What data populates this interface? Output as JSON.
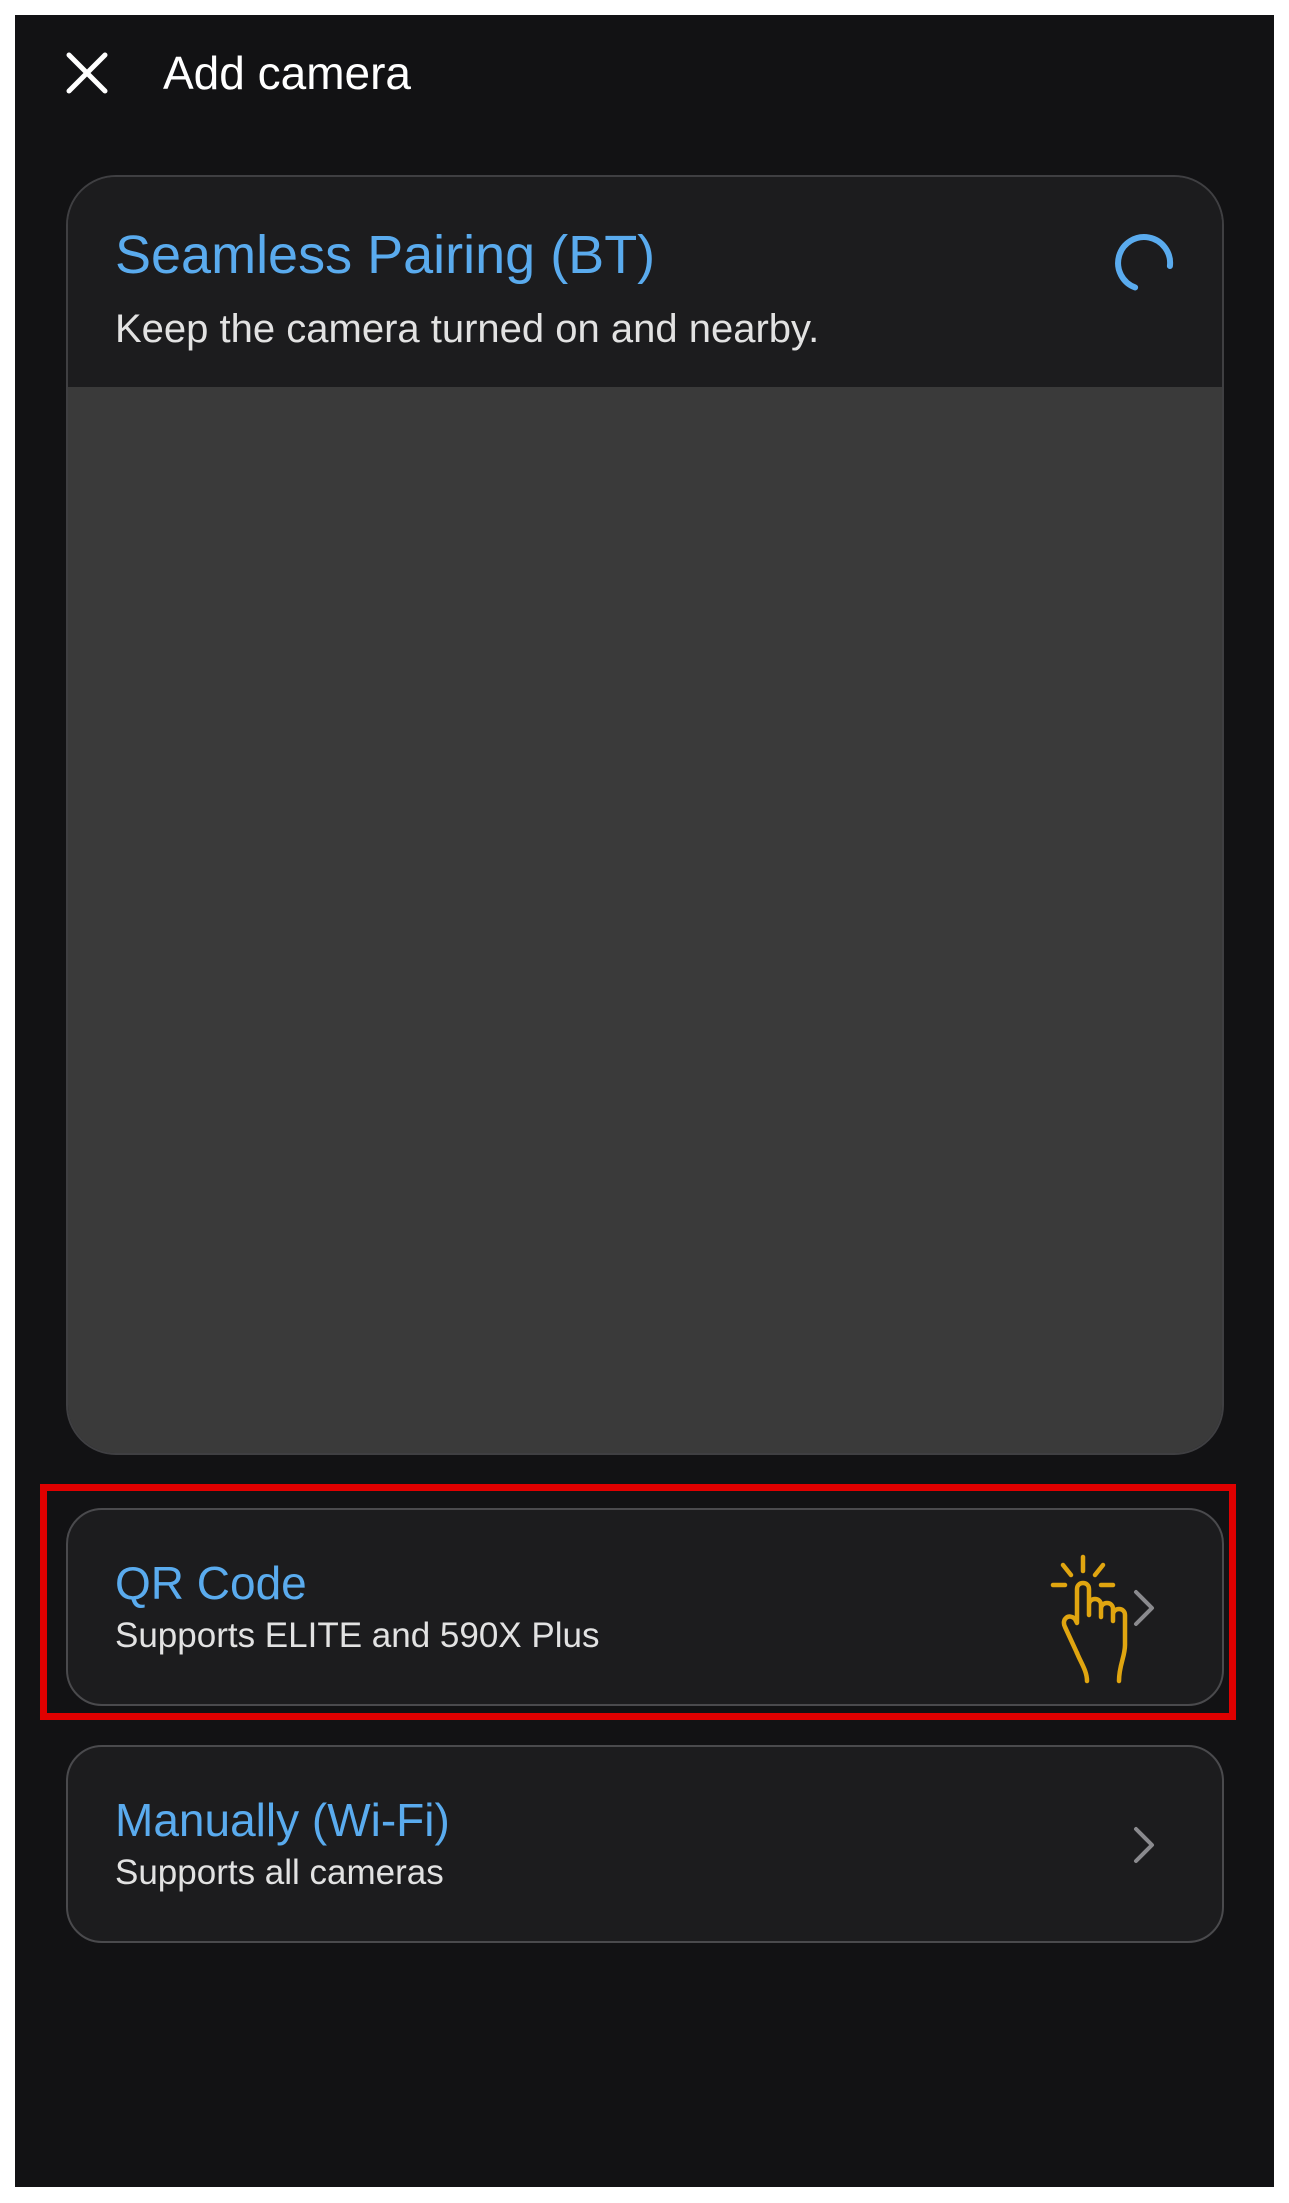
{
  "header": {
    "title": "Add camera",
    "close_icon": "close-icon"
  },
  "bt_card": {
    "title": "Seamless Pairing (BT)",
    "subtitle": "Keep the camera turned on and nearby.",
    "spinner_icon": "loading-spinner-icon"
  },
  "options": [
    {
      "title": "QR Code",
      "subtitle": "Supports ELITE and 590X Plus",
      "icon": "chevron-right-icon"
    },
    {
      "title": "Manually (Wi-Fi)",
      "subtitle": "Supports all cameras",
      "icon": "chevron-right-icon"
    }
  ],
  "annotation": {
    "highlight_color": "#e00000",
    "tap_icon": "tap-hand-icon",
    "tap_color": "#e0a510"
  },
  "colors": {
    "background": "#121214",
    "card": "#1c1c1e",
    "accent": "#5aabee",
    "scan_area": "#3a3a3a"
  }
}
